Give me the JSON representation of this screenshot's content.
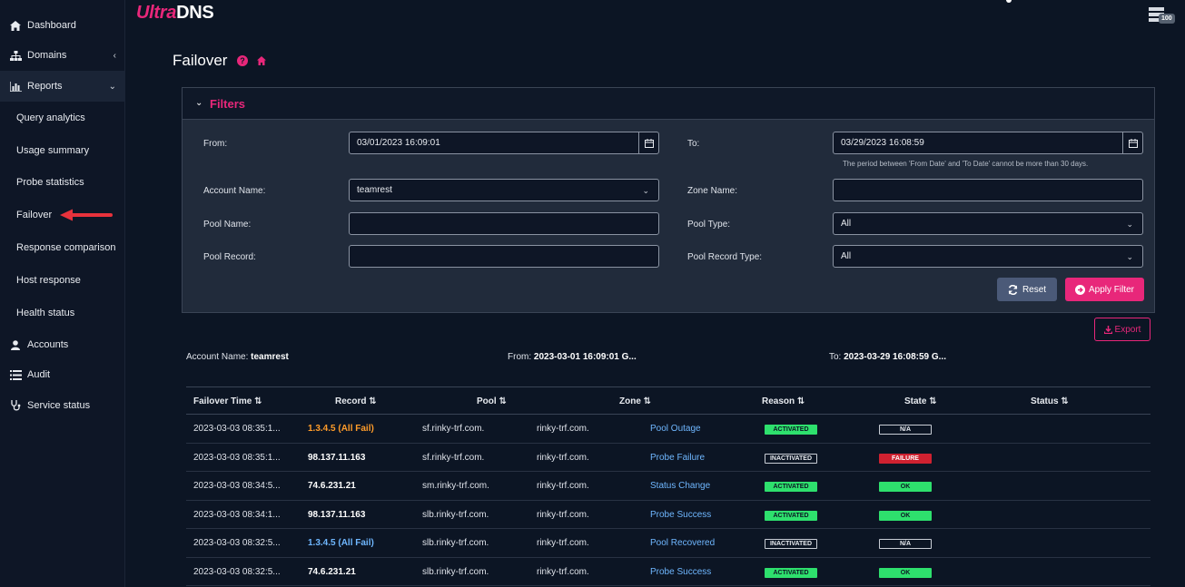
{
  "colors": {
    "accent": "#e8277a",
    "activated": "#2ee06d",
    "ok": "#2ee06d",
    "failure": "#cf2130",
    "record_orange": "#ff9c2a",
    "record_blue": "#6fb7ff",
    "record_white": "#ffffff"
  },
  "header": {
    "logo_ultra": "Ultra",
    "logo_dns": "DNS",
    "notifications_count": "100"
  },
  "sidebar": {
    "items": [
      {
        "label": "Dashboard",
        "icon": "home-icon"
      },
      {
        "label": "Domains",
        "icon": "sitemap-icon"
      },
      {
        "label": "Reports",
        "icon": "bar-chart-icon"
      },
      {
        "label": "Accounts",
        "icon": "user-icon"
      },
      {
        "label": "Audit",
        "icon": "list-icon"
      },
      {
        "label": "Service status",
        "icon": "stethoscope-icon"
      }
    ],
    "report_items": [
      "Query analytics",
      "Usage summary",
      "Probe statistics",
      "Failover",
      "Response comparison",
      "Host response",
      "Health status"
    ]
  },
  "page": {
    "title": "Failover"
  },
  "filters": {
    "title": "Filters",
    "from_label": "From:",
    "from_value": "03/01/2023 16:09:01",
    "to_label": "To:",
    "to_value": "03/29/2023 16:08:59",
    "period_hint": "The period between 'From Date' and 'To Date' cannot be more than 30 days.",
    "account_name_label": "Account Name:",
    "account_name_value": "teamrest",
    "zone_name_label": "Zone Name:",
    "zone_name_value": "",
    "pool_name_label": "Pool Name:",
    "pool_name_value": "",
    "pool_type_label": "Pool Type:",
    "pool_type_value": "All",
    "pool_record_label": "Pool Record:",
    "pool_record_value": "",
    "pool_record_type_label": "Pool Record Type:",
    "pool_record_type_value": "All",
    "reset_label": "Reset",
    "apply_label": "Apply Filter"
  },
  "export_label": "Export",
  "summary": {
    "account_label": "Account Name:",
    "account_value": "teamrest",
    "from_label": "From:",
    "from_value": "2023-03-01 16:09:01 G...",
    "to_label": "To:",
    "to_value": "2023-03-29 16:08:59 G..."
  },
  "table": {
    "columns": [
      "Failover Time ⇅",
      "Record ⇅",
      "Pool ⇅",
      "Zone ⇅",
      "Reason ⇅",
      "State ⇅",
      "Status ⇅"
    ],
    "rows": [
      {
        "time": "2023-03-03 08:35:1...",
        "record": "1.3.4.5 (All Fail)",
        "record_color": "orange",
        "pool": "sf.rinky-trf.com.",
        "zone": "rinky-trf.com.",
        "reason": "Pool Outage",
        "state": "ACTIVATED",
        "status": "N/A"
      },
      {
        "time": "2023-03-03 08:35:1...",
        "record": "98.137.11.163",
        "record_color": "white",
        "pool": "sf.rinky-trf.com.",
        "zone": "rinky-trf.com.",
        "reason": "Probe Failure",
        "state": "INACTIVATED",
        "status": "FAILURE"
      },
      {
        "time": "2023-03-03 08:34:5...",
        "record": "74.6.231.21",
        "record_color": "white",
        "pool": "sm.rinky-trf.com.",
        "zone": "rinky-trf.com.",
        "reason": "Status Change",
        "state": "ACTIVATED",
        "status": "OK"
      },
      {
        "time": "2023-03-03 08:34:1...",
        "record": "98.137.11.163",
        "record_color": "white",
        "pool": "slb.rinky-trf.com.",
        "zone": "rinky-trf.com.",
        "reason": "Probe Success",
        "state": "ACTIVATED",
        "status": "OK"
      },
      {
        "time": "2023-03-03 08:32:5...",
        "record": "1.3.4.5 (All Fail)",
        "record_color": "blue",
        "pool": "slb.rinky-trf.com.",
        "zone": "rinky-trf.com.",
        "reason": "Pool Recovered",
        "state": "INACTIVATED",
        "status": "N/A"
      },
      {
        "time": "2023-03-03 08:32:5...",
        "record": "74.6.231.21",
        "record_color": "white",
        "pool": "slb.rinky-trf.com.",
        "zone": "rinky-trf.com.",
        "reason": "Probe Success",
        "state": "ACTIVATED",
        "status": "OK"
      }
    ]
  }
}
